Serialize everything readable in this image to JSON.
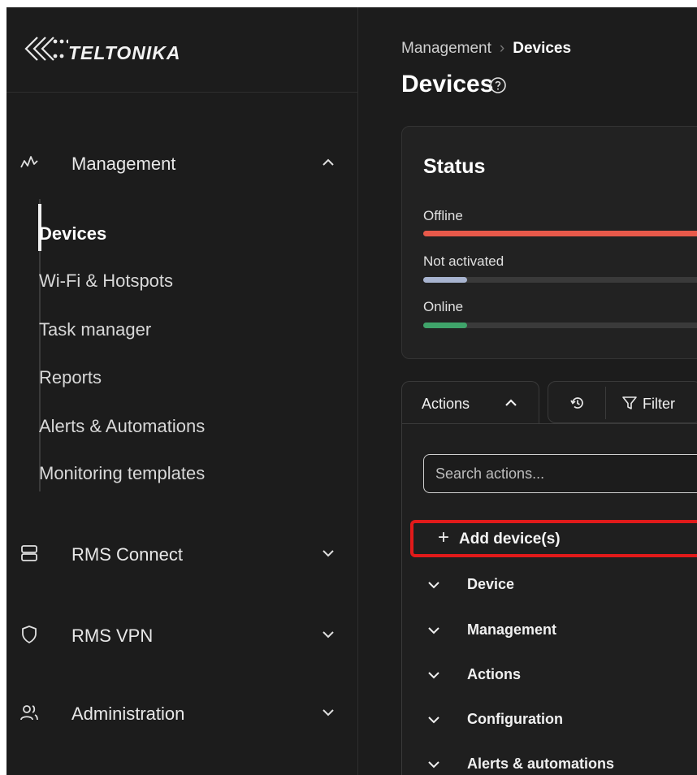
{
  "brand": {
    "name": "TELTONIKA"
  },
  "sidebar": {
    "groups": [
      {
        "label": "Management",
        "icon": "activity-icon",
        "expanded": true
      },
      {
        "label": "RMS Connect",
        "icon": "server-icon",
        "expanded": false
      },
      {
        "label": "RMS VPN",
        "icon": "shield-icon",
        "expanded": false
      },
      {
        "label": "Administration",
        "icon": "users-icon",
        "expanded": false
      }
    ],
    "management_items": [
      {
        "label": "Devices",
        "active": true
      },
      {
        "label": "Wi-Fi & Hotspots"
      },
      {
        "label": "Task manager"
      },
      {
        "label": "Reports"
      },
      {
        "label": "Alerts & Automations"
      },
      {
        "label": "Monitoring templates"
      }
    ]
  },
  "header": {
    "breadcrumb": {
      "parent": "Management",
      "current": "Devices"
    },
    "title": "Devices"
  },
  "status": {
    "title": "Status",
    "items": [
      {
        "label": "Offline",
        "color": "#e8594a",
        "fraction": 1.0
      },
      {
        "label": "Not activated",
        "color": "#a8b4d0",
        "fraction": 0.15
      },
      {
        "label": "Online",
        "color": "#3fa46a",
        "fraction": 0.15
      }
    ]
  },
  "toolbar": {
    "actions_label": "Actions",
    "filter_label": "Filter"
  },
  "actions_panel": {
    "search_placeholder": "Search actions...",
    "add_label": "Add device(s)",
    "highlight_color": "#e11a1a",
    "sections": [
      "Device",
      "Management",
      "Actions",
      "Configuration",
      "Alerts & automations"
    ]
  }
}
